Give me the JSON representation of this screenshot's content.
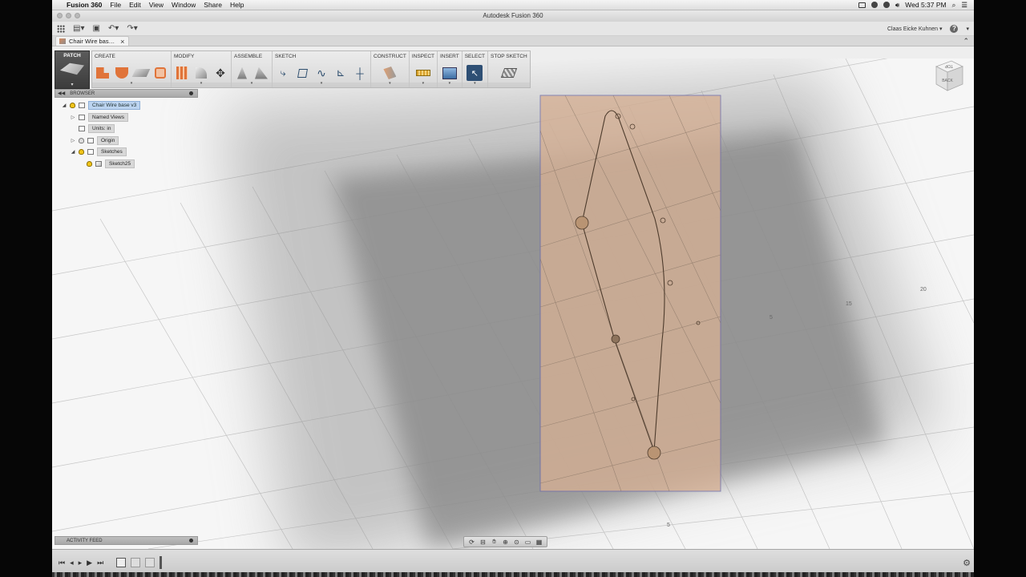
{
  "menubar": {
    "app_name": "Fusion 360",
    "items": [
      "File",
      "Edit",
      "View",
      "Window",
      "Share",
      "Help"
    ],
    "clock": "Wed 5:37 PM"
  },
  "window": {
    "title": "Autodesk Fusion 360"
  },
  "qat": {
    "user": "Claas Eicke Kuhnen ▾"
  },
  "tab": {
    "title": "Chair Wire bas…"
  },
  "toolbar": {
    "workspace": "PATCH",
    "panels": {
      "create": "CREATE",
      "modify": "MODIFY",
      "assemble": "ASSEMBLE",
      "sketch": "SKETCH",
      "construct": "CONSTRUCT",
      "inspect": "INSPECT",
      "insert": "INSERT",
      "select": "SELECT",
      "stop_sketch": "STOP SKETCH"
    }
  },
  "browser": {
    "title": "BROWSER",
    "nodes": {
      "root": "Chair Wire base v3",
      "named_views": "Named Views",
      "units": "Units: in",
      "origin": "Origin",
      "sketches": "Sketches",
      "sketch": "Sketch25"
    }
  },
  "activity_feed": {
    "title": "ACTIVITY FEED"
  },
  "viewcube": {
    "top": "TOP",
    "back": "BACK"
  },
  "grid_labels": {
    "a": "20",
    "b": "15",
    "c": "5",
    "d": "5"
  },
  "icons": {
    "apple": "apple-icon",
    "grid": "grid-icon",
    "file": "file-icon",
    "save": "save-icon",
    "undo": "undo-icon",
    "redo": "redo-icon",
    "help": "help-icon",
    "settings": "gear-icon"
  },
  "colors": {
    "sketch_plane": "#d6b094",
    "selected_node": "#bcd4f0",
    "create_accent": "#e0743a"
  }
}
